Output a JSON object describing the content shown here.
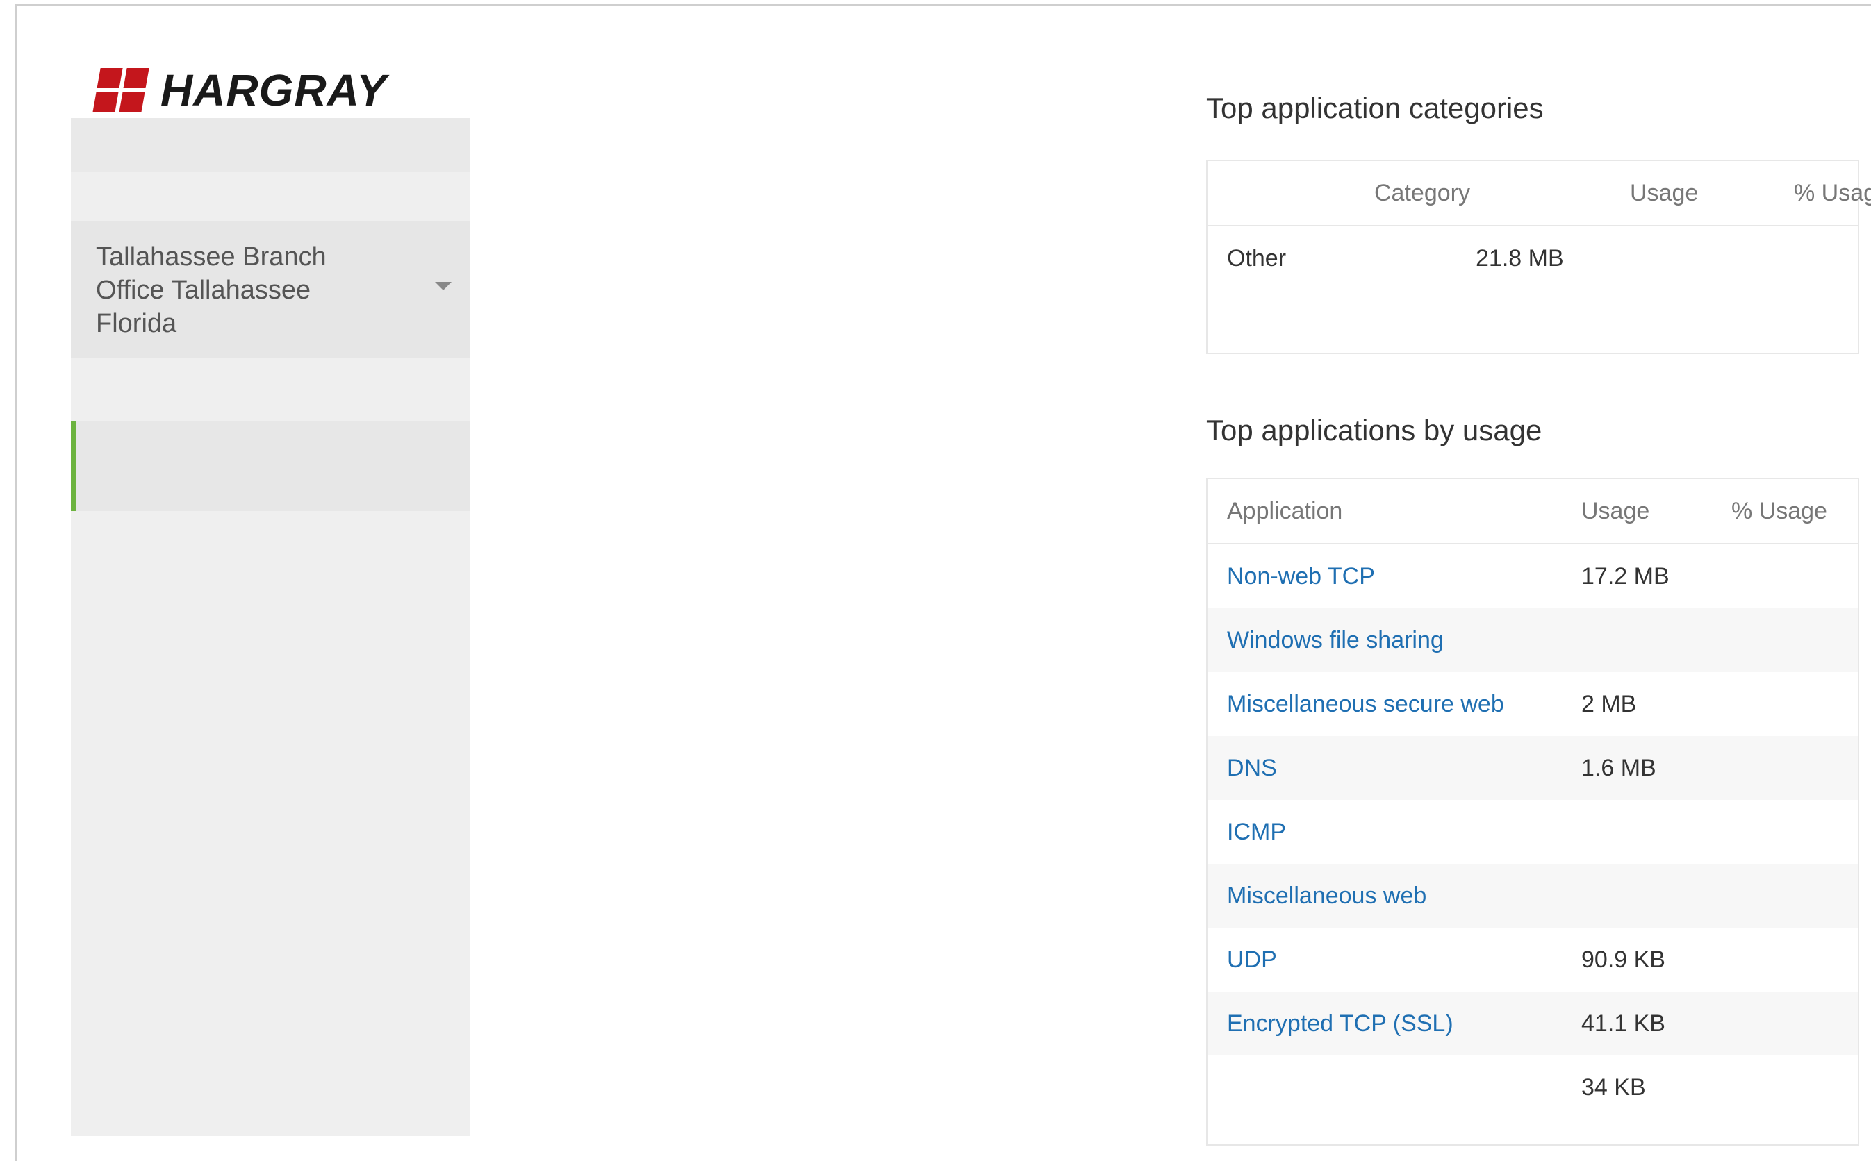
{
  "brand": {
    "logo_text": "HARGRAY",
    "accent_color": "#c4161c",
    "active_color": "#6cb33f",
    "link_color": "#1f6fb2"
  },
  "sidebar": {
    "location_selector": {
      "value_lines": [
        "Tallahassee Branch",
        "Office Tallahassee",
        "Florida"
      ],
      "icon": "chevron-down-icon"
    }
  },
  "categories_panel": {
    "title": "Top application categories",
    "columns": [
      "Category",
      "Usage",
      "% Usage"
    ],
    "rows": [
      {
        "category": "Other",
        "usage": "21.8 MB",
        "percent": ""
      }
    ]
  },
  "applications_panel": {
    "title": "Top applications by usage",
    "columns": [
      "Application",
      "Usage",
      "% Usage"
    ],
    "rows": [
      {
        "application": "Non-web TCP",
        "usage": "17.2 MB",
        "percent": ""
      },
      {
        "application": "Windows file sharing",
        "usage": "",
        "percent": ""
      },
      {
        "application": "Miscellaneous secure web",
        "usage": "2 MB",
        "percent": ""
      },
      {
        "application": "DNS",
        "usage": "1.6 MB",
        "percent": ""
      },
      {
        "application": "ICMP",
        "usage": "",
        "percent": ""
      },
      {
        "application": "Miscellaneous web",
        "usage": "",
        "percent": ""
      },
      {
        "application": "UDP",
        "usage": "90.9 KB",
        "percent": ""
      },
      {
        "application": "Encrypted TCP (SSL)",
        "usage": "41.1 KB",
        "percent": ""
      },
      {
        "application": "",
        "usage": "34 KB",
        "percent": ""
      }
    ]
  }
}
